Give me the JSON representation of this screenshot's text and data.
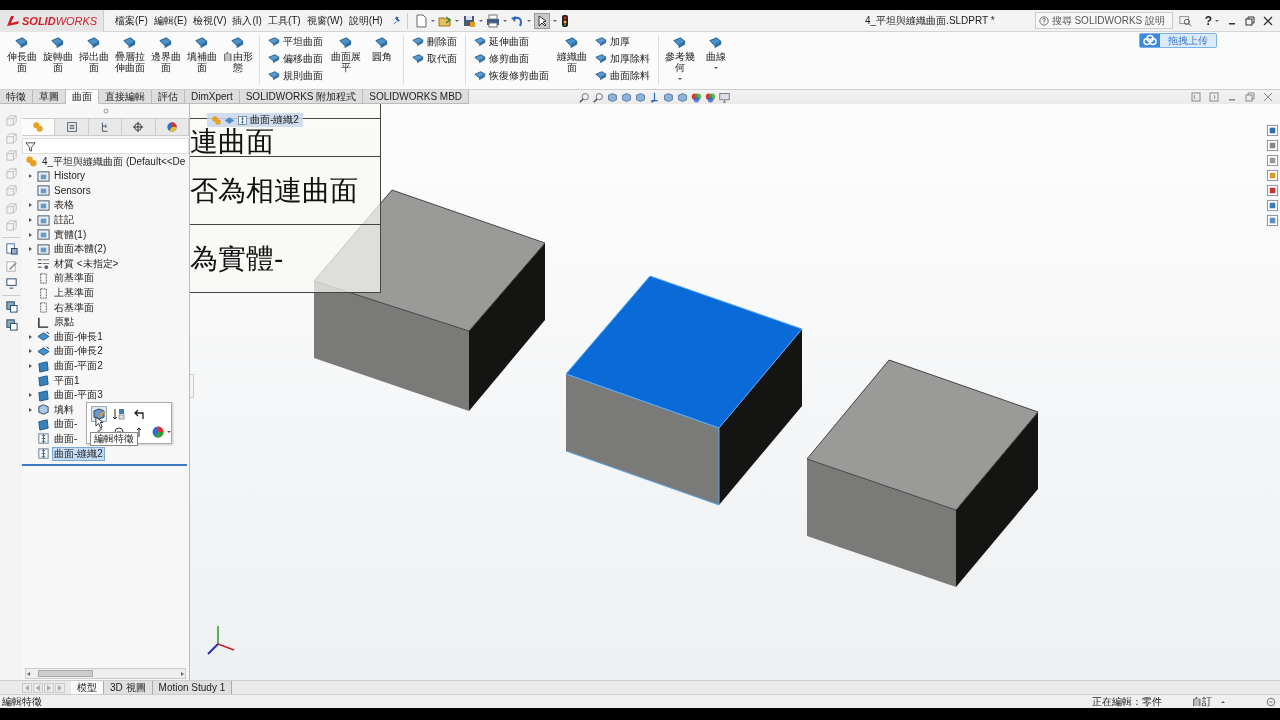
{
  "title_bar": {
    "logo": "**SOLID**WORKS",
    "menu": [
      "檔案(F)",
      "編輯(E)",
      "檢視(V)",
      "插入(I)",
      "工具(T)",
      "視窗(W)",
      "說明(H)"
    ],
    "document_title": "4_平坦與縫織曲面.SLDPRT *",
    "help_search": {
      "placeholder": "搜尋 SOLIDWORKS 說明"
    },
    "help_button": "?"
  },
  "upload_button": "拖拽上传",
  "ribbon": [
    {
      "kind": "large",
      "label": "伸長曲面",
      "dropdown": false
    },
    {
      "kind": "large",
      "label": "旋轉曲面",
      "dropdown": false
    },
    {
      "kind": "large",
      "label": "掃出曲面",
      "dropdown": false
    },
    {
      "kind": "large",
      "label": "疊層拉伸曲面",
      "dropdown": false
    },
    {
      "kind": "large",
      "label": "邊界曲面",
      "dropdown": false
    },
    {
      "kind": "large",
      "label": "填補曲面",
      "dropdown": false
    },
    {
      "kind": "large",
      "label": "自由形態",
      "dropdown": false
    },
    {
      "kind": "separator"
    },
    {
      "kind": "stack",
      "items": [
        "平坦曲面",
        "偏移曲面",
        "規則曲面"
      ]
    },
    {
      "kind": "large",
      "label": "曲面展平",
      "dropdown": false
    },
    {
      "kind": "large",
      "label": "圓角",
      "dropdown": false
    },
    {
      "kind": "separator"
    },
    {
      "kind": "stack",
      "items": [
        "刪除面",
        "取代面"
      ]
    },
    {
      "kind": "separator"
    },
    {
      "kind": "stack",
      "items": [
        "延伸曲面",
        "修剪曲面",
        "恢復修剪曲面"
      ]
    },
    {
      "kind": "large",
      "label": "縫織曲面",
      "dropdown": false
    },
    {
      "kind": "stack",
      "items": [
        "加厚",
        "加厚除料",
        "曲面除料"
      ]
    },
    {
      "kind": "separator"
    },
    {
      "kind": "large",
      "label": "參考幾何",
      "dropdown": true
    },
    {
      "kind": "large",
      "label": "曲線",
      "dropdown": true
    }
  ],
  "command_tabs": [
    {
      "label": "特徵",
      "selected": false
    },
    {
      "label": "草圖",
      "selected": false
    },
    {
      "label": "曲面",
      "selected": true
    },
    {
      "label": "直接編輯",
      "selected": false
    },
    {
      "label": "評估",
      "selected": false
    },
    {
      "label": "DimXpert",
      "selected": false
    },
    {
      "label": "SOLIDWORKS 附加程式",
      "selected": false
    },
    {
      "label": "SOLIDWORKS MBD",
      "selected": false
    }
  ],
  "panel_tabs": [
    {
      "selected": true
    },
    {
      "selected": false
    },
    {
      "selected": false
    },
    {
      "selected": false
    },
    {
      "selected": false
    }
  ],
  "tree": {
    "root": "4_平坦與縫織曲面  (Default<<De",
    "items": [
      {
        "label": "History",
        "kind": "folder",
        "expandable": true,
        "selected": false
      },
      {
        "label": "Sensors",
        "kind": "folder",
        "expandable": false,
        "selected": false
      },
      {
        "label": "表格",
        "kind": "folder",
        "expandable": true,
        "selected": false
      },
      {
        "label": "註記",
        "kind": "folder",
        "expandable": true,
        "selected": false
      },
      {
        "label": "實體(1)",
        "kind": "folder",
        "expandable": true,
        "selected": false
      },
      {
        "label": "曲面本體(2)",
        "kind": "folder",
        "expandable": true,
        "selected": false
      },
      {
        "label": "材質 <未指定>",
        "kind": "material",
        "expandable": false,
        "selected": false
      },
      {
        "label": "前基準面",
        "kind": "plane",
        "expandable": false,
        "selected": false
      },
      {
        "label": "上基準面",
        "kind": "plane",
        "expandable": false,
        "selected": false
      },
      {
        "label": "右基準面",
        "kind": "plane",
        "expandable": false,
        "selected": false
      },
      {
        "label": "原點",
        "kind": "origin",
        "expandable": false,
        "selected": false
      },
      {
        "label": "曲面-伸長1",
        "kind": "extrude",
        "expandable": true,
        "selected": false
      },
      {
        "label": "曲面-伸長2",
        "kind": "extrude",
        "expandable": true,
        "selected": false
      },
      {
        "label": "曲面-平面2",
        "kind": "surface",
        "expandable": true,
        "selected": false
      },
      {
        "label": "平面1",
        "kind": "surface",
        "expandable": false,
        "selected": false
      },
      {
        "label": "曲面-平面3",
        "kind": "surface",
        "expandable": true,
        "selected": false
      },
      {
        "label": "填料",
        "kind": "fill",
        "expandable": true,
        "selected": false
      },
      {
        "label": "曲面-",
        "kind": "surface",
        "expandable": false,
        "selected": false
      },
      {
        "label": "曲面-",
        "kind": "knit",
        "expandable": false,
        "selected": false
      },
      {
        "label": "曲面-縫織2",
        "kind": "knit",
        "expandable": false,
        "selected": true
      }
    ]
  },
  "context_toolbar": {
    "tooltip": "編輯特徵"
  },
  "breadcrumb": "曲面-縫織2",
  "slide_table": {
    "rows": [
      "連曲面",
      "否為相連曲面",
      "為實體-"
    ]
  },
  "bottom_tabs": [
    {
      "label": "模型",
      "selected": true
    },
    {
      "label": "3D 視圖",
      "selected": false
    },
    {
      "label": "Motion Study 1",
      "selected": false
    }
  ],
  "status_bar": {
    "message": "編輯特徵",
    "editing": "正在編輯：零件",
    "units": "自訂"
  }
}
